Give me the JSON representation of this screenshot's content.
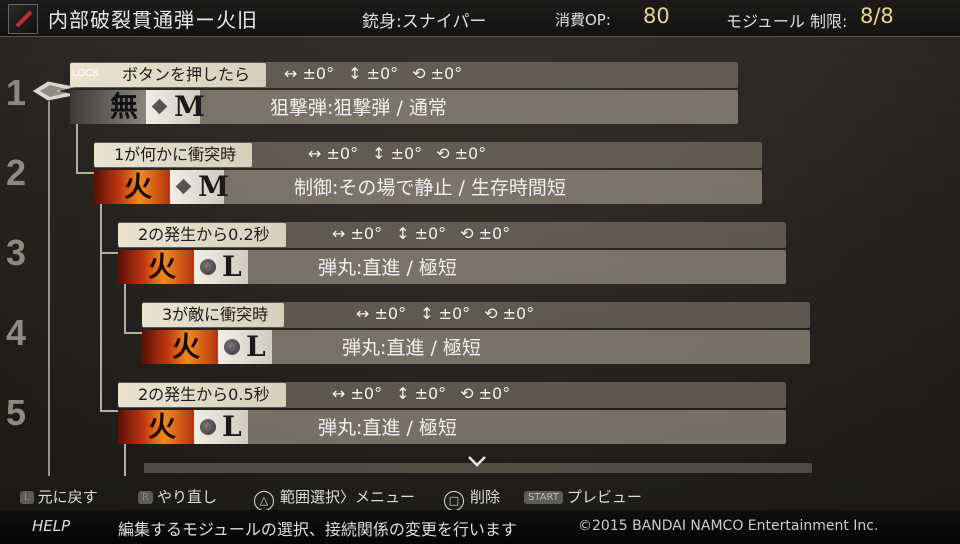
{
  "header": {
    "bullet_name": "内部破裂貫通弾ー火旧",
    "barrel": "銃身:スナイパー",
    "op_label": "消費OP:",
    "op_value": "80",
    "module_label": "モジュール 制限:",
    "module_value": "8/8"
  },
  "levels": [
    "1",
    "2",
    "3",
    "4",
    "5"
  ],
  "lock_label": "LOCK",
  "angles": {
    "h": "↔ ±0°",
    "v": "↕ ±0°",
    "r": "⟲ ±0°"
  },
  "modules": [
    {
      "condition": "ボタンを押したら",
      "element": "無",
      "size": "M",
      "description": "狙撃弾:狙撃弾 / 通常"
    },
    {
      "condition": "1が何かに衝突時",
      "element": "火",
      "size": "M",
      "description": "制御:その場で静止 / 生存時間短"
    },
    {
      "condition": "2の発生から0.2秒",
      "element": "火",
      "size": "L",
      "description": "弾丸:直進 / 極短"
    },
    {
      "condition": "3が敵に衝突時",
      "element": "火",
      "size": "L",
      "description": "弾丸:直進 / 極短"
    },
    {
      "condition": "2の発生から0.5秒",
      "element": "火",
      "size": "L",
      "description": "弾丸:直進 / 極短"
    }
  ],
  "footer": {
    "hints": {
      "l_key": "L",
      "l_label": "元に戻す",
      "r_key": "R",
      "r_label": "やり直し",
      "triangle_label": "範囲選択〉メニュー",
      "circle_label": "削除",
      "start_key": "START",
      "start_label": "プレビュー"
    },
    "help_label": "HELP",
    "help_text": "編集するモジュールの選択、接続関係の変更を行います",
    "copyright": "©2015 BANDAI NAMCO Entertainment Inc."
  }
}
